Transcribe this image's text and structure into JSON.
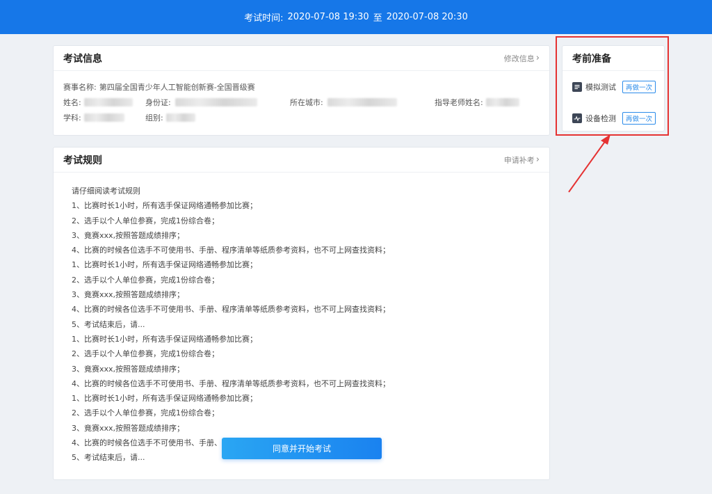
{
  "header": {
    "time_label": "考试时间:",
    "start": "2020-07-08 19:30",
    "separator": "至",
    "end": "2020-07-08 20:30"
  },
  "info": {
    "title": "考试信息",
    "link": "修改信息",
    "event_label": "赛事名称:",
    "event_value": "第四届全国青少年人工智能创新赛-全国晋级赛",
    "name_label": "姓名:",
    "id_label": "身份证:",
    "city_label": "所在城市:",
    "teacher_label": "指导老师姓名:",
    "subject_label": "学科:",
    "group_label": "组别:"
  },
  "rules": {
    "title": "考试规则",
    "link": "申请补考",
    "lines": [
      "请仔细阅读考试规则",
      "1、比赛时长1小时，所有选手保证网络通畅参加比赛；",
      "2、选手以个人单位参赛，完成1份综合卷；",
      "3、竟赛xxx,按照答题成绩排序；",
      "4、比赛的时候各位选手不可使用书、手册、程序清单等纸质参考资料，也不可上网查找资料；",
      "1、比赛时长1小时，所有选手保证网络通畅参加比赛；",
      "2、选手以个人单位参赛，完成1份综合卷；",
      "3、竟赛xxx,按照答题成绩排序；",
      "4、比赛的时候各位选手不可使用书、手册、程序清单等纸质参考资料，也不可上网查找资料；",
      "5、考试结束后，请...",
      "1、比赛时长1小时，所有选手保证网络通畅参加比赛；",
      "2、选手以个人单位参赛，完成1份综合卷；",
      "3、竟赛xxx,按照答题成绩排序；",
      "4、比赛的时候各位选手不可使用书、手册、程序清单等纸质参考资料，也不可上网查找资料；",
      "1、比赛时长1小时，所有选手保证网络通畅参加比赛；",
      "2、选手以个人单位参赛，完成1份综合卷；",
      "3、竟赛xxx,按照答题成绩排序；",
      "4、比赛的时候各位选手不可使用书、手册、程",
      "5、考试结束后，请..."
    ],
    "start_button": "同意并开始考试"
  },
  "prep": {
    "title": "考前准备",
    "items": [
      {
        "label": "模拟测试",
        "icon": "document-list-icon",
        "button": "再做一次"
      },
      {
        "label": "设备检测",
        "icon": "pulse-icon",
        "button": "再做一次"
      }
    ]
  },
  "colors": {
    "header_bg": "#1677e8",
    "accent": "#2a8bea",
    "highlight": "#e53232"
  }
}
